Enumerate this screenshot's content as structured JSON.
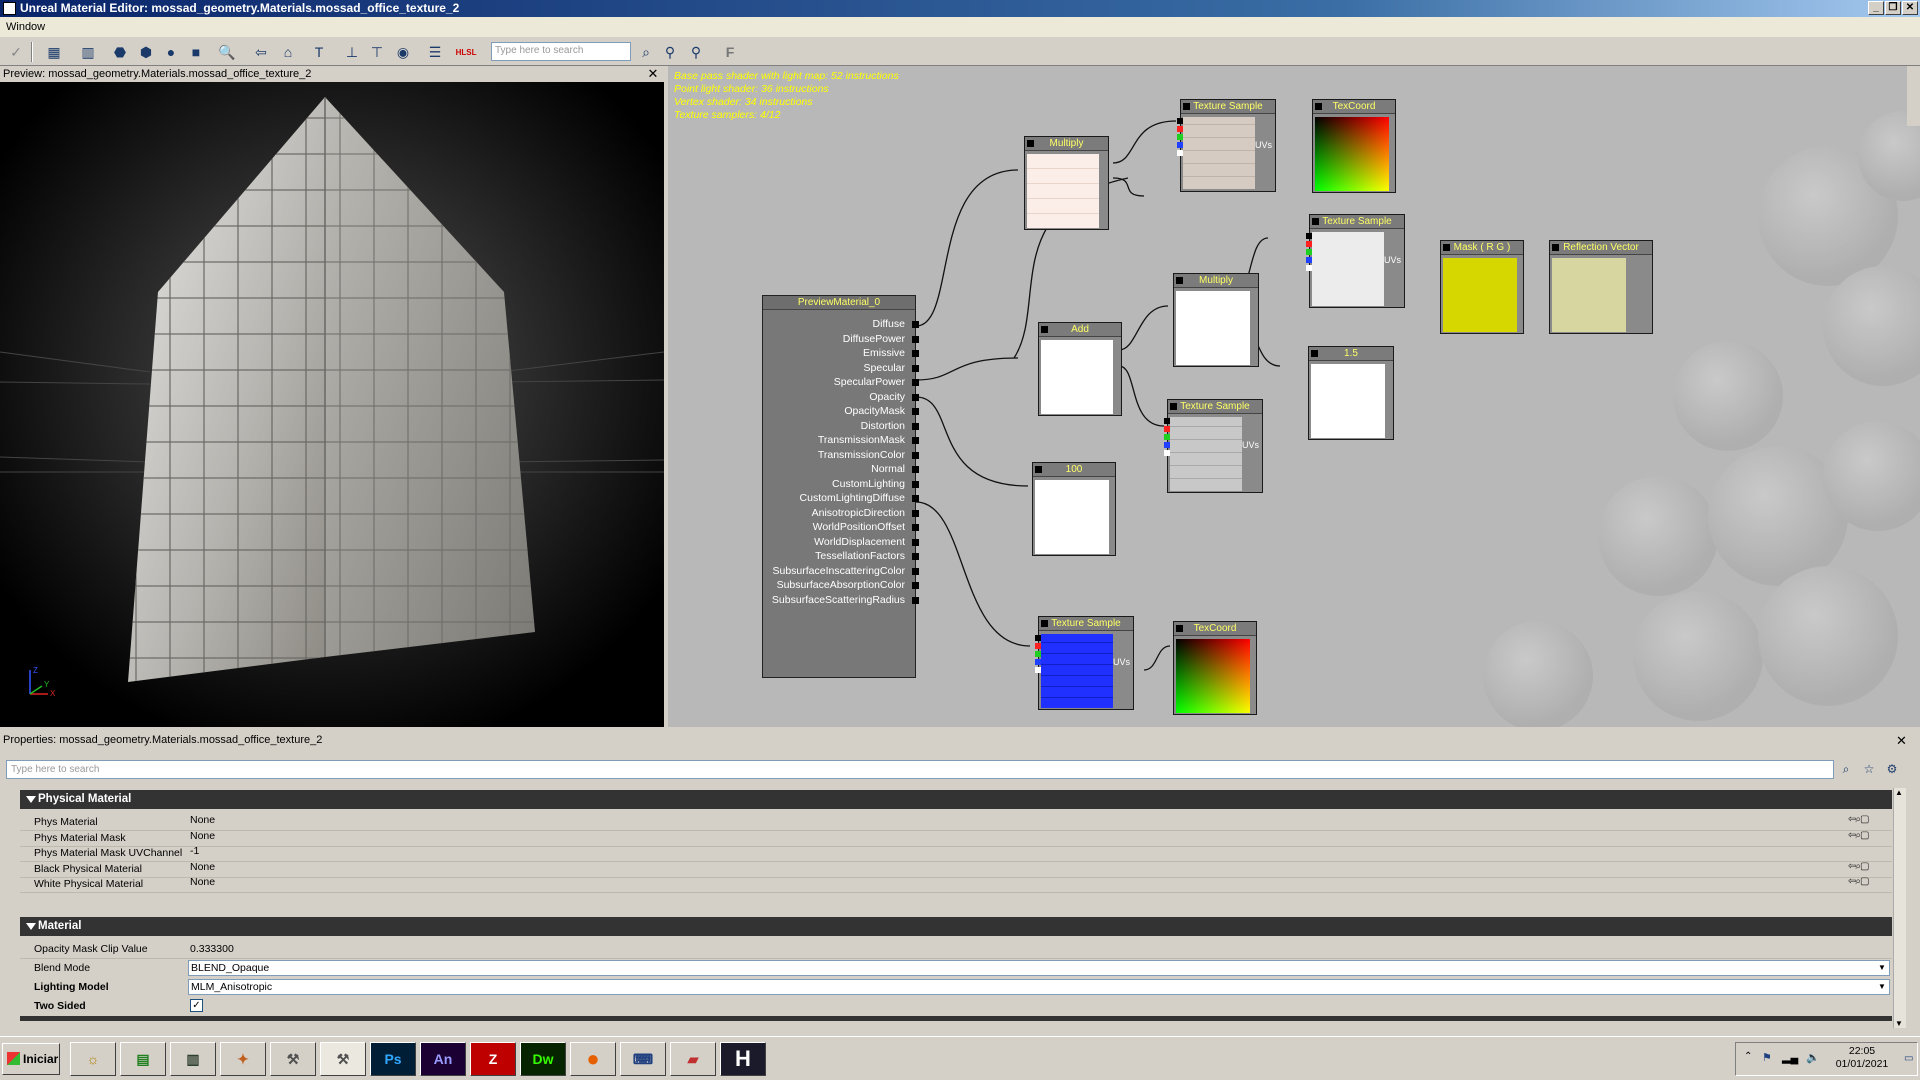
{
  "window": {
    "title": "Unreal Material Editor: mossad_geometry.Materials.mossad_office_texture_2"
  },
  "menu": {
    "window": "Window"
  },
  "toolbar": {
    "search_placeholder": "Type here to search",
    "hlsl": "HLSL"
  },
  "preview": {
    "title": "Preview: mossad_geometry.Materials.mossad_office_texture_2",
    "axis_z": "Z",
    "axis_x": "X",
    "axis_y": "Y"
  },
  "stats": {
    "line1": "Base pass shader with light map: 52 instructions",
    "line2": "Point light shader: 36 instructions",
    "line3": "Vertex shader: 34 instructions",
    "line4": "Texture samplers: 4/12"
  },
  "nodes": {
    "material": "PreviewMaterial_0",
    "multiply1": "Multiply",
    "texsample1": "Texture Sample",
    "texcoord1": "TexCoord",
    "texsample2": "Texture Sample",
    "mask": "Mask ( R G )",
    "reflection": "Reflection Vector",
    "multiply2": "Multiply",
    "add": "Add",
    "const15": "1.5",
    "texsample3": "Texture Sample",
    "const100": "100",
    "texsample4": "Texture Sample",
    "texcoord2": "TexCoord",
    "uvs": "UVs"
  },
  "material_inputs": [
    "Diffuse",
    "DiffusePower",
    "Emissive",
    "Specular",
    "SpecularPower",
    "Opacity",
    "OpacityMask",
    "Distortion",
    "TransmissionMask",
    "TransmissionColor",
    "Normal",
    "CustomLighting",
    "CustomLightingDiffuse",
    "AnisotropicDirection",
    "WorldPositionOffset",
    "WorldDisplacement",
    "TessellationFactors",
    "SubsurfaceInscatteringColor",
    "SubsurfaceAbsorptionColor",
    "SubsurfaceScatteringRadius"
  ],
  "properties": {
    "title": "Properties: mossad_geometry.Materials.mossad_office_texture_2",
    "search_placeholder": "Type here to search",
    "cat_physical": "Physical Material",
    "cat_material": "Material",
    "phys_rows": [
      {
        "label": "Phys Material",
        "value": "None"
      },
      {
        "label": "Phys Material Mask",
        "value": "None"
      },
      {
        "label": "Phys Material Mask UVChannel",
        "value": "-1"
      },
      {
        "label": "Black Physical Material",
        "value": "None"
      },
      {
        "label": "White Physical Material",
        "value": "None"
      }
    ],
    "opacity_label": "Opacity Mask Clip Value",
    "opacity_value": "0.333300",
    "blend_label": "Blend Mode",
    "blend_value": "BLEND_Opaque",
    "lighting_label": "Lighting Model",
    "lighting_value": "MLM_Anisotropic",
    "twosided_label": "Two Sided",
    "twosided_check": "✓"
  },
  "taskbar": {
    "start": "Iniciar",
    "apps": [
      "Ps",
      "An",
      "Dw",
      "H"
    ],
    "time": "22:05",
    "date": "01/01/2021"
  },
  "colors": {
    "title_bar": "#0a246a",
    "node_header_text": "#ffff66",
    "stats_text": "#ffff00",
    "graph_bg": "#b8b8b8"
  }
}
